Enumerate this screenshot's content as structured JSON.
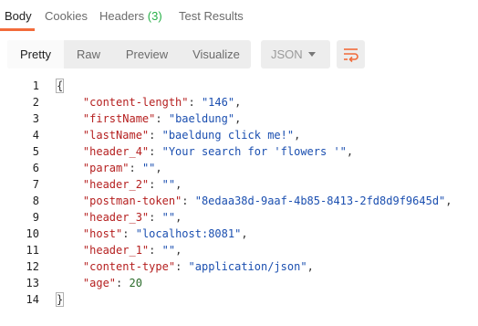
{
  "tabs": [
    {
      "label": "Body",
      "active": true
    },
    {
      "label": "Cookies",
      "active": false
    },
    {
      "label": "Headers",
      "count": "(3)",
      "active": false
    },
    {
      "label": "Test Results",
      "active": false
    }
  ],
  "accent_color": "#f26b3a",
  "count_color": "#26b047",
  "format_buttons": [
    "Pretty",
    "Raw",
    "Preview",
    "Visualize"
  ],
  "selected_format": "Pretty",
  "language": {
    "selected": "JSON"
  },
  "wrap_button_icon": "wrap-lines-icon",
  "json_lines": [
    {
      "n": "1",
      "open": "{"
    },
    {
      "n": "2",
      "key": "\"content-length\"",
      "val": "\"146\"",
      "comma": ","
    },
    {
      "n": "3",
      "key": "\"firstName\"",
      "val": "\"baeldung\"",
      "comma": ","
    },
    {
      "n": "4",
      "key": "\"lastName\"",
      "val": "\"baeldung click me!\"",
      "comma": ","
    },
    {
      "n": "5",
      "key": "\"header_4\"",
      "val": "\"Your search for 'flowers '\"",
      "comma": ","
    },
    {
      "n": "6",
      "key": "\"param\"",
      "val": "\"\"",
      "comma": ","
    },
    {
      "n": "7",
      "key": "\"header_2\"",
      "val": "\"\"",
      "comma": ","
    },
    {
      "n": "8",
      "key": "\"postman-token\"",
      "val": "\"8edaa38d-9aaf-4b85-8413-2fd8d9f9645d\"",
      "comma": ","
    },
    {
      "n": "9",
      "key": "\"header_3\"",
      "val": "\"\"",
      "comma": ","
    },
    {
      "n": "10",
      "key": "\"host\"",
      "val": "\"localhost:8081\"",
      "comma": ","
    },
    {
      "n": "11",
      "key": "\"header_1\"",
      "val": "\"\"",
      "comma": ","
    },
    {
      "n": "12",
      "key": "\"content-type\"",
      "val": "\"application/json\"",
      "comma": ","
    },
    {
      "n": "13",
      "key": "\"age\"",
      "num": "20"
    },
    {
      "n": "14",
      "close": "}"
    }
  ]
}
